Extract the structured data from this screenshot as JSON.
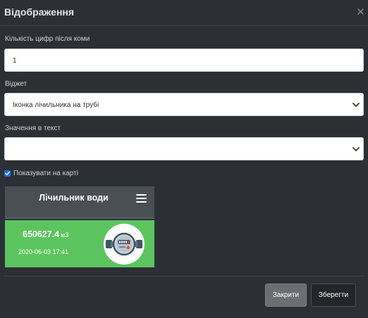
{
  "dialog": {
    "title": "Відображення"
  },
  "form": {
    "decimals_label": "Кількість цифр після коми",
    "decimals_value": "1",
    "widget_label": "Віджет",
    "widget_value": "Іконка лічильника на трубі",
    "text_value_label": "Значення в текст",
    "text_value_value": "",
    "show_on_map_label": "Показувати на карті",
    "show_on_map_checked": true
  },
  "widget_preview": {
    "title": "Лічильник води",
    "value": "650627.4",
    "unit": "м3",
    "datetime": "2020-06-03 17:41",
    "header_color": "#4a4f55",
    "body_color": "#5cc45f",
    "icon": "water-meter-icon"
  },
  "footer": {
    "close_label": "Закрити",
    "save_label": "Зберегти"
  }
}
